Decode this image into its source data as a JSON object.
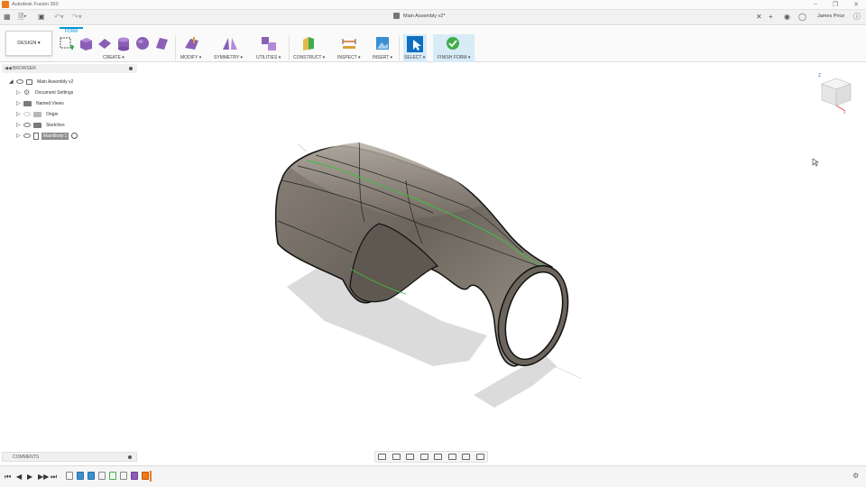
{
  "app": {
    "title": "Autodesk Fusion 360"
  },
  "document": {
    "tab_title": "Main Assembly v2*"
  },
  "user": {
    "name": "James Price"
  },
  "workspace": {
    "label": "DESIGN"
  },
  "ribbon": {
    "active_tab": "FORM",
    "groups": [
      {
        "label": "CREATE ▾"
      },
      {
        "label": "MODIFY ▾"
      },
      {
        "label": "SYMMETRY ▾"
      },
      {
        "label": "UTILITIES ▾"
      },
      {
        "label": "CONSTRUCT ▾"
      },
      {
        "label": "INSPECT ▾"
      },
      {
        "label": "INSERT ▾"
      },
      {
        "label": "SELECT ▾"
      },
      {
        "label": "FINISH FORM ▾"
      }
    ]
  },
  "browser": {
    "title": "BROWSER",
    "items": [
      {
        "label": "Main Assembly v2"
      },
      {
        "label": "Document Settings"
      },
      {
        "label": "Named Views"
      },
      {
        "label": "Origin"
      },
      {
        "label": "Sketches"
      },
      {
        "label": "MainBody:1"
      }
    ]
  },
  "comments": {
    "title": "COMMENTS"
  },
  "colors": {
    "accent": "#0696d7",
    "finish": "#3fae49",
    "edge_green": "#3fbf3f"
  },
  "icons": [
    "apps-grid-icon",
    "file-icon",
    "save-icon",
    "undo-icon",
    "redo-icon",
    "close-tab-icon",
    "new-tab-icon",
    "extensions-icon",
    "job-status-icon",
    "help-icon",
    "viewcube-icon",
    "settings-gear-icon"
  ]
}
